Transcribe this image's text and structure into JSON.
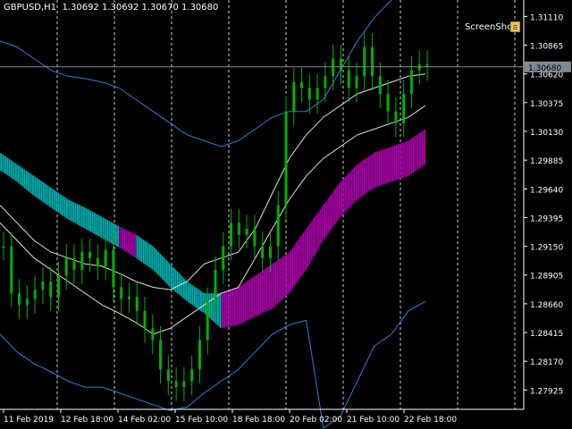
{
  "header": {
    "symbol_label": "GBPUSD,H1",
    "ohlc_label": "1.30692 1.30692 1.30670 1.30680"
  },
  "toolbar": {
    "screenshot_label": "ScreenShot",
    "screenshot_icon": "screenshot-icon"
  },
  "colors": {
    "background": "#000000",
    "axis": "#ffffff",
    "candle": "#00b000",
    "channel_up": "#00c8c8",
    "channel_down": "#c000c0",
    "outer_band": "#2e7fd6",
    "inner_band": "#e0e0e0",
    "bid_line": "#808898",
    "price_label_bg": "#808898"
  },
  "chart_data": {
    "type": "candlestick",
    "symbol": "GBPUSD",
    "timeframe": "H1",
    "ylim": [
      1.2776,
      1.3125
    ],
    "y_ticks": [
      "1.31110",
      "1.30865",
      "1.30620",
      "1.30375",
      "1.30130",
      "1.29885",
      "1.29640",
      "1.29395",
      "1.29150",
      "1.28905",
      "1.28660",
      "1.28415",
      "1.28170",
      "1.27925"
    ],
    "x_ticks": [
      "11 Feb 2019",
      "12 Feb 18:00",
      "14 Feb 02:00",
      "15 Feb 10:00",
      "18 Feb 18:00",
      "20 Feb 02:00",
      "21 Feb 10:00",
      "22 Feb 18:00"
    ],
    "current_price": "1.30680",
    "grid": "vertical dashed",
    "close_series": [
      1.2915,
      1.2875,
      1.2865,
      1.287,
      1.2878,
      1.2885,
      1.2872,
      1.289,
      1.2905,
      1.2895,
      1.291,
      1.2905,
      1.2898,
      1.2912,
      1.288,
      1.287,
      1.2872,
      1.286,
      1.2845,
      1.2835,
      1.281,
      1.28,
      1.2795,
      1.28,
      1.281,
      1.2835,
      1.2868,
      1.2895,
      1.2915,
      1.2935,
      1.2925,
      1.293,
      1.2915,
      1.2905,
      1.2915,
      1.295,
      1.303,
      1.3055,
      1.305,
      1.304,
      1.305,
      1.306,
      1.3075,
      1.3065,
      1.305,
      1.306,
      1.3085,
      1.306,
      1.3045,
      1.303,
      1.302,
      1.3045,
      1.3065,
      1.307,
      1.3068
    ],
    "outer_upper": [
      1.309,
      1.3085,
      1.3075,
      1.3065,
      1.306,
      1.3058,
      1.3055,
      1.305,
      1.304,
      1.303,
      1.302,
      1.301,
      1.3005,
      1.3,
      1.3005,
      1.3015,
      1.3025,
      1.303,
      1.303,
      1.304,
      1.3065,
      1.309,
      1.311,
      1.3125,
      1.313,
      1.3135
    ],
    "outer_lower": [
      1.284,
      1.2825,
      1.2815,
      1.2808,
      1.28,
      1.2795,
      1.2795,
      1.279,
      1.2785,
      1.278,
      1.2775,
      1.2778,
      1.279,
      1.28,
      1.281,
      1.2825,
      1.284,
      1.2848,
      1.2852,
      1.276,
      1.277,
      1.28,
      1.283,
      1.284,
      1.286,
      1.2868
    ],
    "inner_upper": [
      1.295,
      1.2935,
      1.292,
      1.291,
      1.2905,
      1.29,
      1.2898,
      1.2892,
      1.2885,
      1.288,
      1.2878,
      1.2885,
      1.29,
      1.2905,
      1.291,
      1.293,
      1.296,
      1.299,
      1.301,
      1.3025,
      1.3035,
      1.3045,
      1.305,
      1.3055,
      1.306,
      1.3062
    ],
    "inner_lower": [
      1.2935,
      1.292,
      1.2905,
      1.2895,
      1.2885,
      1.2875,
      1.2865,
      1.2858,
      1.285,
      1.284,
      1.2845,
      1.2855,
      1.2865,
      1.2875,
      1.288,
      1.2905,
      1.293,
      1.2955,
      1.2975,
      1.299,
      1.3,
      1.301,
      1.3015,
      1.302,
      1.3025,
      1.3035
    ],
    "channel_top": [
      1.2995,
      1.2985,
      1.2975,
      1.2965,
      1.2955,
      1.2948,
      1.294,
      1.2932,
      1.2925,
      1.2915,
      1.29,
      1.2885,
      1.2875,
      1.2875,
      1.288,
      1.289,
      1.29,
      1.291,
      1.293,
      1.295,
      1.297,
      1.2985,
      1.2995,
      1.3,
      1.3005,
      1.3015
    ],
    "channel_bottom": [
      1.298,
      1.297,
      1.2958,
      1.2948,
      1.2938,
      1.293,
      1.2922,
      1.2914,
      1.2905,
      1.2895,
      1.288,
      1.2868,
      1.2858,
      1.2845,
      1.2848,
      1.2855,
      1.2862,
      1.2875,
      1.2895,
      1.292,
      1.294,
      1.2955,
      1.2965,
      1.297,
      1.2975,
      1.2985
    ],
    "channel_state": [
      "up",
      "up",
      "up",
      "up",
      "up",
      "up",
      "up",
      "down",
      "up",
      "up",
      "up",
      "up",
      "up",
      "down",
      "down",
      "down",
      "down",
      "down",
      "down",
      "down",
      "down",
      "down",
      "down",
      "down",
      "down",
      "down"
    ]
  }
}
